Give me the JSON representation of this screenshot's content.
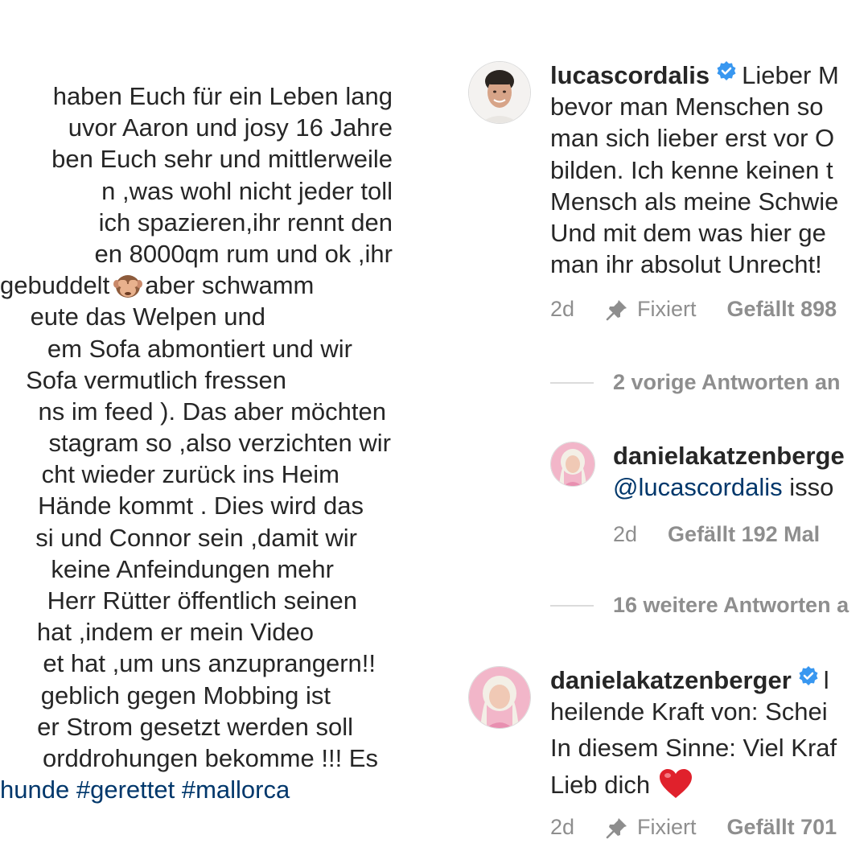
{
  "caption": {
    "lines": [
      "haben Euch für ein Leben lang",
      "uvor Aaron und josy 16 Jahre",
      "ben Euch sehr und mittlerweile",
      "n ,was wohl nicht jeder toll",
      "ich spazieren,ihr rennt den",
      "en 8000qm rum und ok ,ihr",
      "gebuddelt",
      "aber schwamm",
      "eute das Welpen und",
      "em Sofa abmontiert und wir",
      "Sofa vermutlich fressen",
      "ns im feed ). Das aber möchten",
      "stagram so ,also verzichten wir",
      "cht wieder zurück ins Heim",
      "Hände kommt . Dies wird das",
      "si und Connor sein ,damit wir",
      "keine Anfeindungen mehr",
      "Herr Rütter öffentlich seinen",
      "hat ,indem er mein Video",
      "et hat ,um uns anzuprangern!!",
      "geblich gegen Mobbing ist",
      "er Strom gesetzt werden soll",
      "orddrohungen bekomme !!! Es"
    ],
    "hashtags": [
      "hunde",
      "#gerettet",
      "#mallorca"
    ],
    "emoji": "see-no-evil-monkey-icon"
  },
  "comments": {
    "first": {
      "username": "lucascordalis",
      "text_lines": [
        "Lieber M",
        "bevor man Menschen so",
        "man sich lieber erst vor O",
        "bilden. Ich kenne keinen t",
        "Mensch als meine Schwie",
        "Und mit dem was hier ge",
        "man ihr absolut Unrecht!"
      ],
      "time": "2d",
      "pinned": "Fixiert",
      "likes": "Gefällt 898"
    },
    "prev_replies": "2 vorige Antworten an",
    "reply": {
      "username": "danielakatzenberge",
      "mention": "@lucascordalis",
      "text": "isso",
      "time": "2d",
      "likes": "Gefällt 192 Mal"
    },
    "more_replies": "16 weitere Antworten a",
    "second": {
      "username": "danielakatzenberger",
      "text_lines": [
        "l",
        "heilende Kraft von: Schei",
        "In diesem Sinne: Viel Kraf",
        "Lieb dich"
      ],
      "time": "2d",
      "pinned": "Fixiert",
      "likes": "Gefällt 701"
    }
  },
  "colors": {
    "text": "#262626",
    "muted": "#8e8e8e",
    "link": "#00376b",
    "verified": "#3897f0",
    "heart": "#e0212c"
  }
}
